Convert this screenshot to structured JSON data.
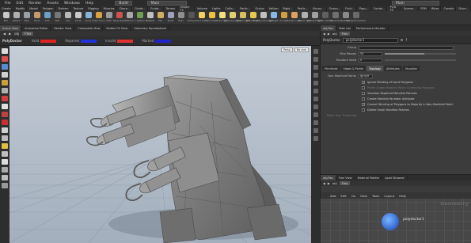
{
  "menubar": {
    "items": [
      "File",
      "Edit",
      "Render",
      "Assets",
      "Windows",
      "Help"
    ],
    "desktop": "Build",
    "context": "Main",
    "right_field": "Main"
  },
  "shelf": {
    "tabs": [
      "Create",
      "Modify",
      "Model",
      "Polygon",
      "Deform",
      "Texture",
      "Rigging",
      "Muscles",
      "Chara...",
      "Guide...",
      "Guide...",
      "Terrain",
      "Simple FX",
      "Volume",
      "Lights",
      "Collis...",
      "Partic...",
      "Grains",
      "Vellum",
      "Rigid...",
      "Partic...",
      "Viscou...",
      "Ocean...",
      "Fluid...",
      "Popu...",
      "Contai...",
      "Pyro FX",
      "Sparse...",
      "FEM",
      "Wires",
      "Crowds",
      "Drive..."
    ],
    "tools": [
      {
        "label": "Box",
        "color": "#c8c8c8"
      },
      {
        "label": "Sphere",
        "color": "#b0b0b0"
      },
      {
        "label": "Tube",
        "color": "#9aa0a8"
      },
      {
        "label": "Torus",
        "color": "#c49a6c"
      },
      {
        "label": "Grid",
        "color": "#6aa0c8"
      },
      {
        "label": "Null",
        "color": "#777"
      },
      {
        "label": "Line",
        "color": "#b8b8b8"
      },
      {
        "label": "Circle",
        "color": "#c9c9c9"
      },
      {
        "label": "Curve",
        "color": "#88b2d8"
      },
      {
        "label": "Draw Curve",
        "color": "#d8a040"
      },
      {
        "label": "Path",
        "color": "#999"
      },
      {
        "label": "Spray Paint",
        "color": "#d05050"
      },
      {
        "label": "Platonic",
        "color": "#a8a8a8"
      },
      {
        "label": "L-System",
        "color": "#6aa050"
      },
      {
        "label": "Metaball",
        "color": "#c0c0c0"
      },
      {
        "label": "File",
        "color": "#d0b060"
      },
      {
        "label": "Spiral",
        "color": "#a0a0c0"
      },
      {
        "label": "Helix",
        "color": "#909090"
      },
      {
        "label": "Camera",
        "color": "#555"
      },
      {
        "label": "Point Light",
        "color": "#f0d060"
      },
      {
        "label": "Spot Light",
        "color": "#f0c040"
      },
      {
        "label": "Area Light",
        "color": "#f0e080"
      },
      {
        "label": "Geometry Light",
        "color": "#e0d070"
      },
      {
        "label": "Volume Light",
        "color": "#d8c060"
      },
      {
        "label": "Distant Light",
        "color": "#e8c850"
      },
      {
        "label": "Environment Light",
        "color": "#c0c0c0"
      },
      {
        "label": "Sky Light",
        "color": "#88b8e8"
      },
      {
        "label": "GI Light",
        "color": "#d0a040"
      },
      {
        "label": "Caustic Light",
        "color": "#e0a060"
      },
      {
        "label": "Portal Light",
        "color": "#b0b0b0"
      },
      {
        "label": "Ambient Light",
        "color": "#a0a0a0"
      },
      {
        "label": "Stereo Camera",
        "color": "#606060"
      },
      {
        "label": "VR Camera",
        "color": "#707070"
      },
      {
        "label": "Switcher",
        "color": "#8a8a8a"
      },
      {
        "label": "Gamepad Camera",
        "color": "#6a6a6a"
      }
    ]
  },
  "viewer": {
    "tabs": [
      "Scene View",
      "Animation Editor",
      "Render View",
      "Composite View",
      "Motion FX View",
      "Geometry Spreadsheet"
    ],
    "active_tab": 0,
    "path": "obj",
    "object": "Flex",
    "op_name": "PolyDoctor",
    "param_labels": [
      "Valid",
      "Repaired",
      "Invalid",
      "Marked"
    ],
    "swatch_colors": [
      "#2222cc",
      "#dd2222",
      "#2233dd",
      "#e03030"
    ],
    "badges": [
      "Persp",
      "No cam"
    ]
  },
  "params": {
    "tabs": [
      "obj/flex",
      "Take List",
      "Performance Monitor"
    ],
    "path": "obj",
    "object": "Flex",
    "node_type": "PolyDoctor",
    "node_name": "polydoctor1",
    "rows": [
      {
        "label": "Group",
        "value": ""
      },
      {
        "label": "Max Passes",
        "value": "50"
      },
      {
        "label": "Random Seed",
        "value": "0"
      }
    ],
    "max_passes_fraction": 0.55,
    "random_seed_fraction": 0.0,
    "subtabs": [
      "Primitives",
      "Edges & Points",
      "Topology",
      "Attributes",
      "Visualize"
    ],
    "active_subtab": 2,
    "nonmanifold_label": "Non-Manifold Points",
    "nonmanifold_value": "Ignore",
    "checks": [
      {
        "label": "Ignore Winding of Input Polygons",
        "checked": true,
        "dim": false
      },
      {
        "label": "Prefer Larger Regions When Correcting Polygons",
        "checked": false,
        "dim": true
      },
      {
        "label": "Visualize Repaired Manifold Patches",
        "checked": false,
        "dim": false
      },
      {
        "label": "Create Manifold Number Attribute",
        "checked": false,
        "dim": false
      },
      {
        "label": "Correct Winding of Polygons to Majority in Non-Manifold Patch",
        "checked": true,
        "dim": false
      },
      {
        "label": "Delete Small Manifold Patches",
        "checked": false,
        "dim": false
      }
    ],
    "patch_threshold_label": "Patch Size Threshold"
  },
  "network": {
    "tabs": [
      "obj/flex",
      "Tree View",
      "Material Palette",
      "Asset Browser"
    ],
    "path": "obj",
    "object": "Flex",
    "menu": [
      "Add",
      "Edit",
      "Go",
      "View",
      "Tools",
      "Layout",
      "Help"
    ],
    "context_label": "Geometry",
    "node_label": "polydoctor1"
  }
}
